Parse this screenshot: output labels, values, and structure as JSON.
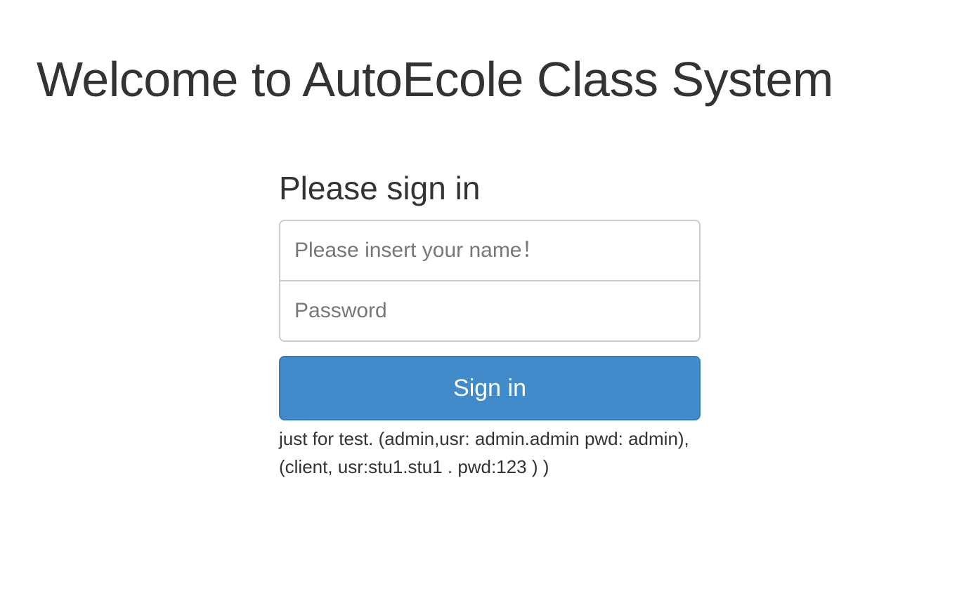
{
  "page": {
    "title": "Welcome to AutoEcole Class System"
  },
  "signin": {
    "heading": "Please sign in",
    "name_placeholder": "Please insert your name！",
    "name_value": "",
    "password_placeholder": "Password",
    "password_value": "",
    "button_label": "Sign in",
    "test_note": "just for test. (admin,usr: admin.admin pwd: admin),(client, usr:stu1.stu1 . pwd:123 ) )"
  },
  "colors": {
    "primary_button": "#428bca",
    "text": "#333333"
  }
}
